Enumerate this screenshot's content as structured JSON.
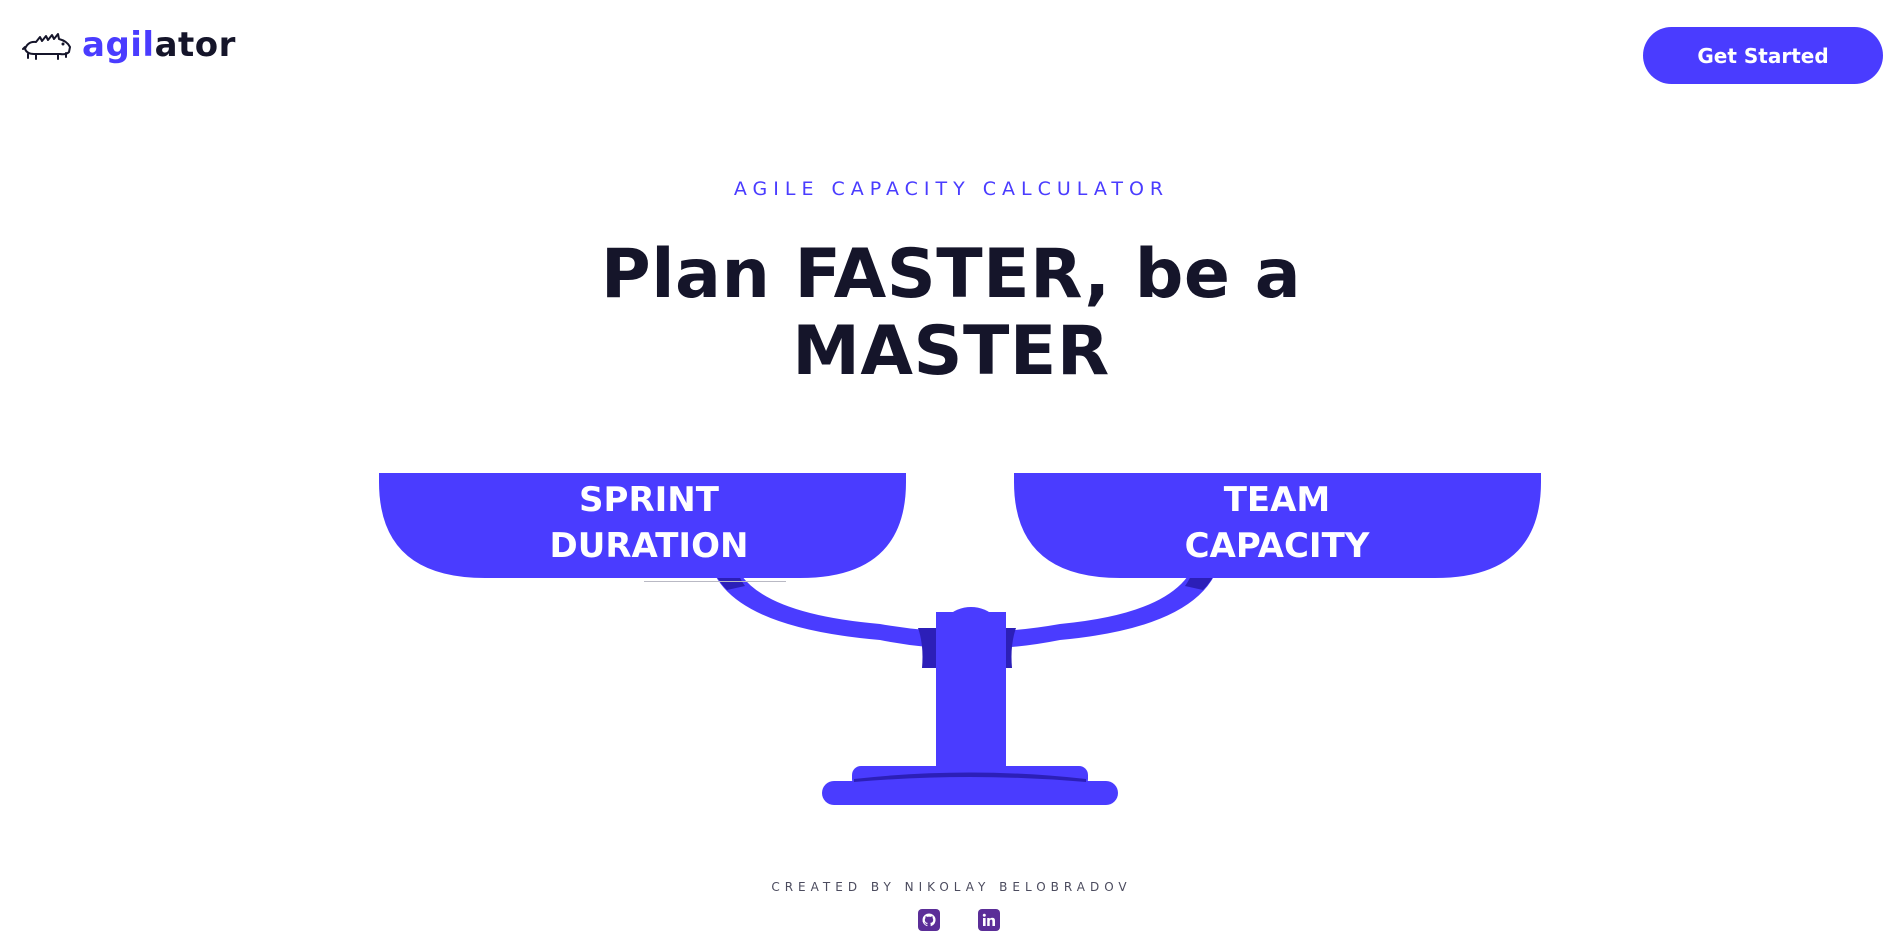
{
  "brand": {
    "accent_part": "agil",
    "rest_part": "ator",
    "logo_icon": "crocodile-icon"
  },
  "header": {
    "cta_label": "Get Started"
  },
  "hero": {
    "eyebrow": "AGILE CAPACITY CALCULATOR",
    "headline_line1": "Plan FASTER, be a",
    "headline_line2": "MASTER"
  },
  "scale": {
    "left_pan": {
      "line1": "SPRINT",
      "line2": "DURATION"
    },
    "right_pan": {
      "line1": "TEAM",
      "line2": "CAPACITY"
    }
  },
  "footer": {
    "credit": "CREATED BY NIKOLAY BELOBRADOV",
    "links": [
      {
        "icon": "github-icon"
      },
      {
        "icon": "linkedin-icon"
      }
    ]
  },
  "colors": {
    "accent": "#4a3cff",
    "accent_dark": "#2c1fb8",
    "text": "#15152a",
    "social": "#5b2e98"
  }
}
